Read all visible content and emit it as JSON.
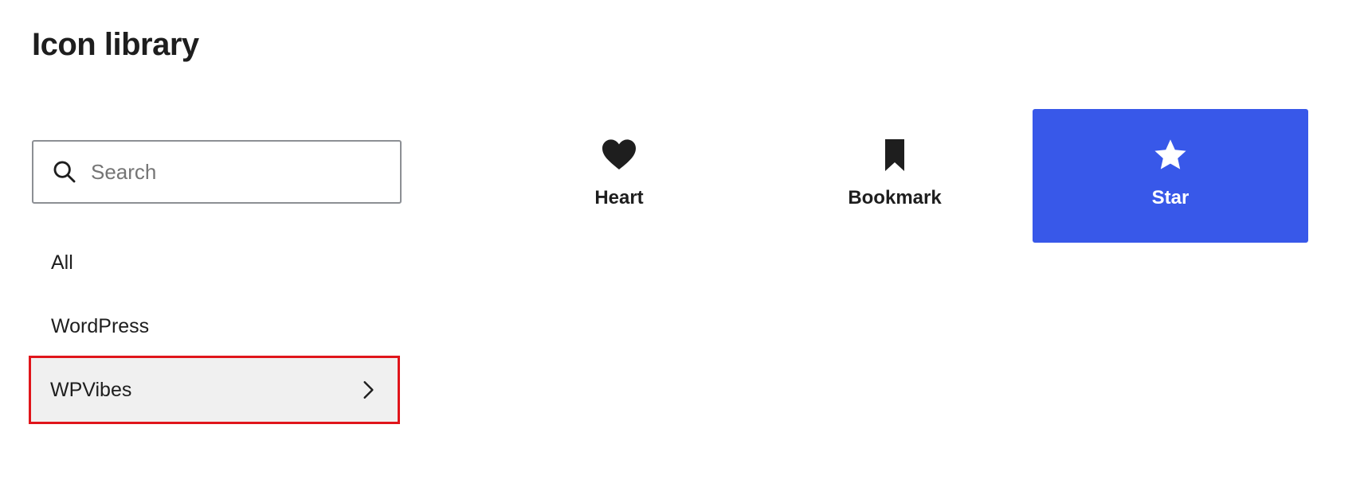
{
  "header": {
    "title": "Icon library"
  },
  "search": {
    "placeholder": "Search",
    "value": ""
  },
  "categories": [
    {
      "label": "All",
      "selected": false
    },
    {
      "label": "WordPress",
      "selected": false
    },
    {
      "label": "WPVibes",
      "selected": true
    }
  ],
  "icons": [
    {
      "label": "Heart",
      "icon": "heart-icon",
      "selected": false
    },
    {
      "label": "Bookmark",
      "icon": "bookmark-icon",
      "selected": false
    },
    {
      "label": "Star",
      "icon": "star-icon",
      "selected": true
    }
  ],
  "colors": {
    "accent": "#3858e9",
    "highlight_outline": "#e0151b",
    "selected_row_bg": "#f0f0f0",
    "text": "#1e1e1e"
  }
}
